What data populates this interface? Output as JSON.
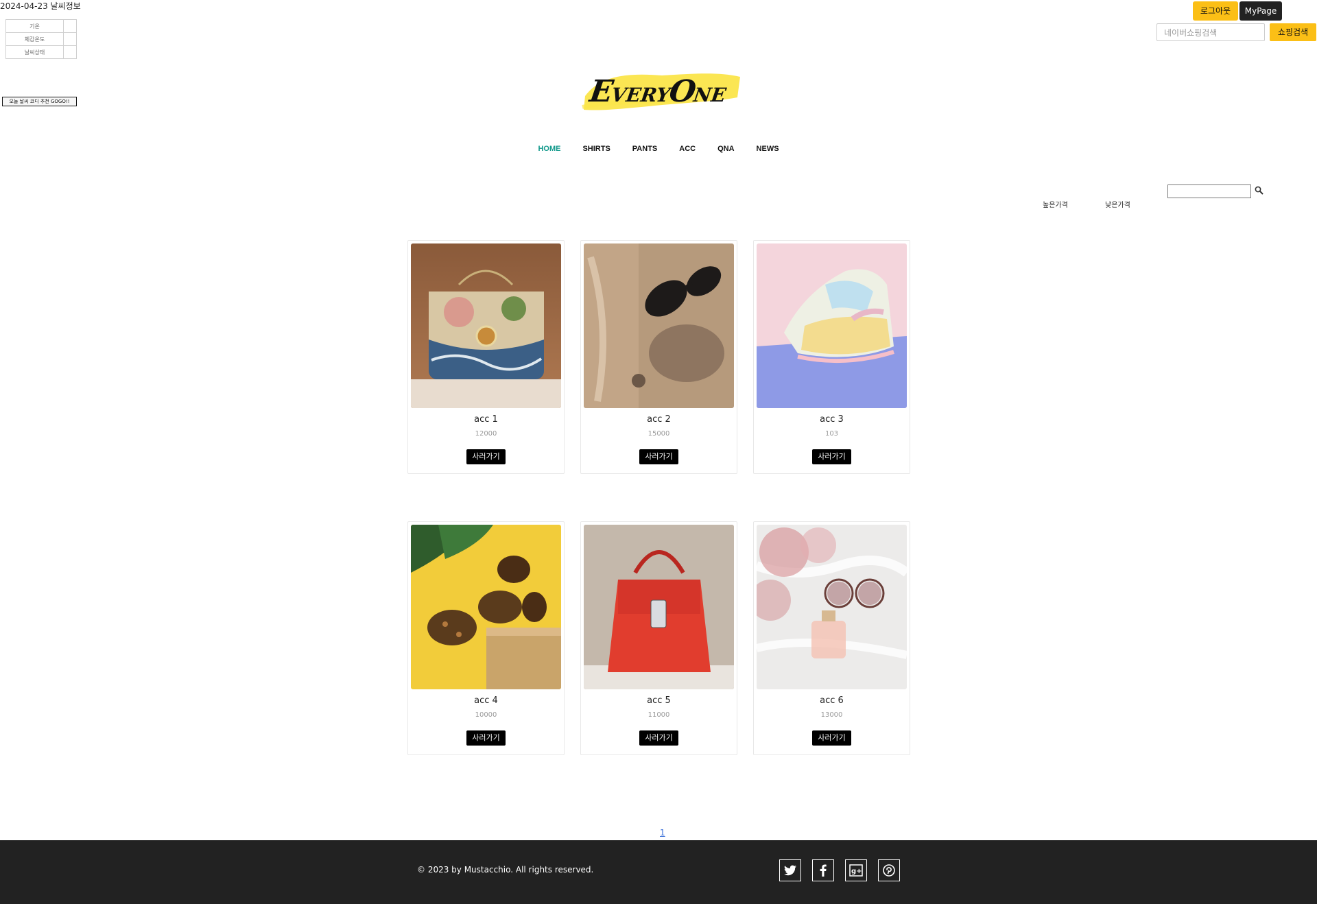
{
  "weather": {
    "date_title": "2024-04-23 날씨정보",
    "rows": [
      "기온",
      "체감온도",
      "날씨상태"
    ],
    "button": "오늘 날씨 코디 추천 GOGO!!"
  },
  "header": {
    "logout_label": "로그아웃",
    "mypage_label": "MyPage",
    "naver_placeholder": "네이버쇼핑검색",
    "naver_button": "쇼핑검색",
    "logo_text": "EveryOne"
  },
  "nav": {
    "items": [
      "HOME",
      "SHIRTS",
      "PANTS",
      "ACC",
      "QNA",
      "NEWS"
    ],
    "active": "HOME"
  },
  "sort": {
    "high": "높은가격",
    "low": "낮은가격"
  },
  "products": [
    {
      "name": "acc 1",
      "price": "12000",
      "buy": "사러가기",
      "image": "patterned-handbag"
    },
    {
      "name": "acc 2",
      "price": "15000",
      "buy": "사러가기",
      "image": "sunglasses-on-fabric"
    },
    {
      "name": "acc 3",
      "price": "103",
      "buy": "사러가기",
      "image": "pastel-sneaker"
    },
    {
      "name": "acc 4",
      "price": "10000",
      "buy": "사러가기",
      "image": "sunglasses-yellow"
    },
    {
      "name": "acc 5",
      "price": "11000",
      "buy": "사러가기",
      "image": "red-handbag"
    },
    {
      "name": "acc 6",
      "price": "13000",
      "buy": "사러가기",
      "image": "sunglasses-perfume"
    }
  ],
  "pagination": {
    "current": "1"
  },
  "footer": {
    "copyright": "© 2023 by Mustacchio. All rights reserved.",
    "social": [
      "twitter-icon",
      "facebook-icon",
      "google-plus-icon",
      "pinterest-icon"
    ]
  },
  "colors": {
    "accent_yellow": "#fbbf16",
    "nav_active": "#139a8c",
    "footer_bg": "#222222"
  }
}
